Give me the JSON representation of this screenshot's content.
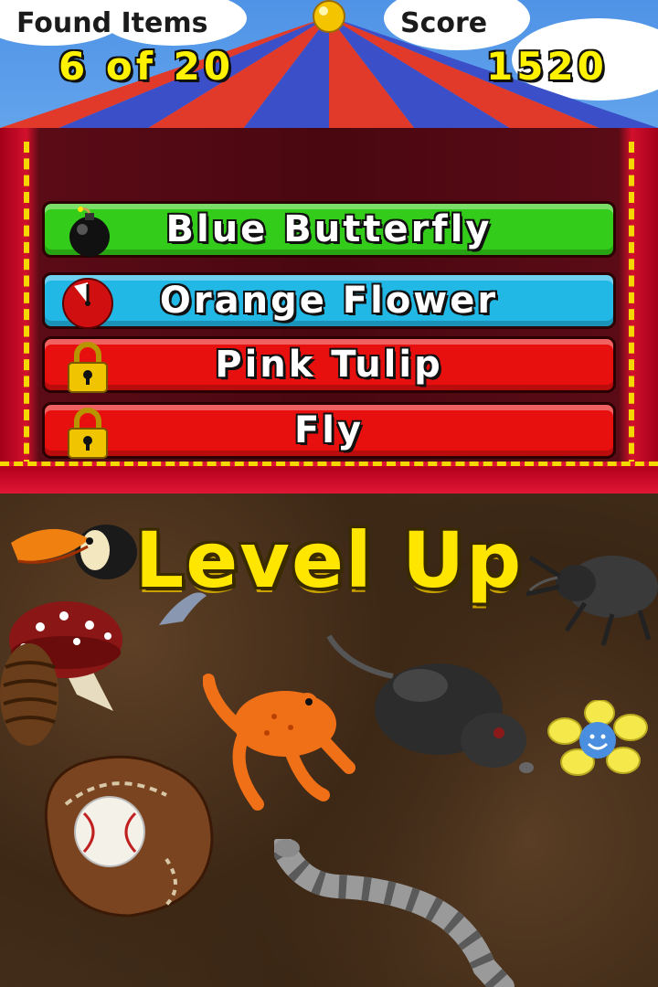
{
  "hud": {
    "found_label": "Found Items",
    "found_value": "6 of 20",
    "score_label": "Score",
    "score_value": "1520"
  },
  "item_list": [
    {
      "label": "Blue Butterfly",
      "status_icon": "bomb-icon",
      "color": "#33cc1a"
    },
    {
      "label": "Orange Flower",
      "status_icon": "clock-icon",
      "color": "#22b8e6"
    },
    {
      "label": "Pink Tulip",
      "status_icon": "lock-icon",
      "color": "#e80f0f"
    },
    {
      "label": "Fly",
      "status_icon": "lock-icon",
      "color": "#e80f0f"
    }
  ],
  "play_field": {
    "banner": "Level Up",
    "objects": [
      "toucan",
      "mushroom",
      "pinecone",
      "frog",
      "rat",
      "beetle",
      "flower",
      "baseball-glove",
      "snake"
    ]
  },
  "colors": {
    "sky": "#5b9ee8",
    "tent_red": "#e23a2a",
    "tent_blue": "#3a4fc8",
    "booth_red": "#c40f2a",
    "accent_yellow": "#ffe600",
    "dirt": "#44301c"
  }
}
